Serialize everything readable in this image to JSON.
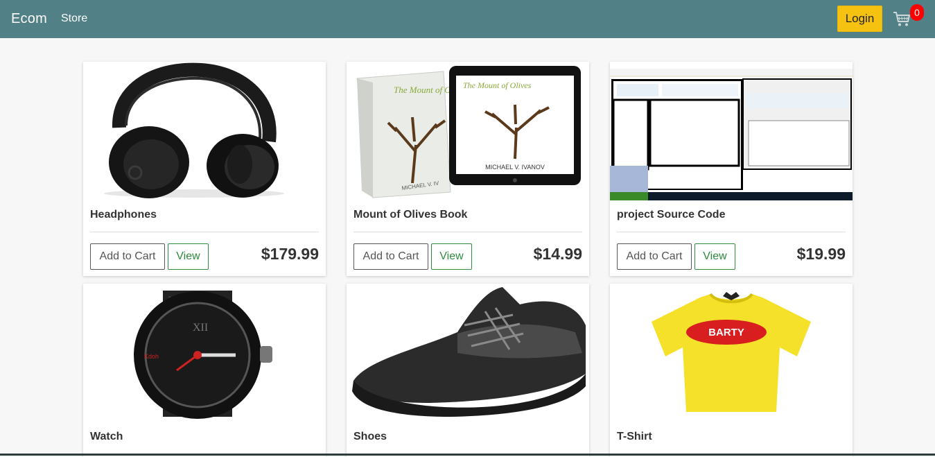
{
  "navbar": {
    "brand": "Ecom",
    "store_link": "Store",
    "login_label": "Login",
    "cart_count": "0",
    "cart_icon": "shopping-cart-icon",
    "bg_color": "#518186",
    "login_color": "#f5c211"
  },
  "products": [
    {
      "title": "Headphones",
      "price": "$179.99",
      "add_label": "Add to Cart",
      "view_label": "View",
      "image": "headphones-image"
    },
    {
      "title": "Mount of Olives Book",
      "price": "$14.99",
      "add_label": "Add to Cart",
      "view_label": "View",
      "image": "book-image",
      "image_text": {
        "cover_title": "The Mount of Olives",
        "author": "MICHAEL V. IVANOV"
      }
    },
    {
      "title": "project Source Code",
      "price": "$19.99",
      "add_label": "Add to Cart",
      "view_label": "View",
      "image": "source-code-screenshot-image"
    },
    {
      "title": "Watch",
      "image": "watch-image"
    },
    {
      "title": "Shoes",
      "image": "shoes-image"
    },
    {
      "title": "T-Shirt",
      "image": "tshirt-image",
      "image_text": {
        "print": "BARTY"
      }
    }
  ]
}
